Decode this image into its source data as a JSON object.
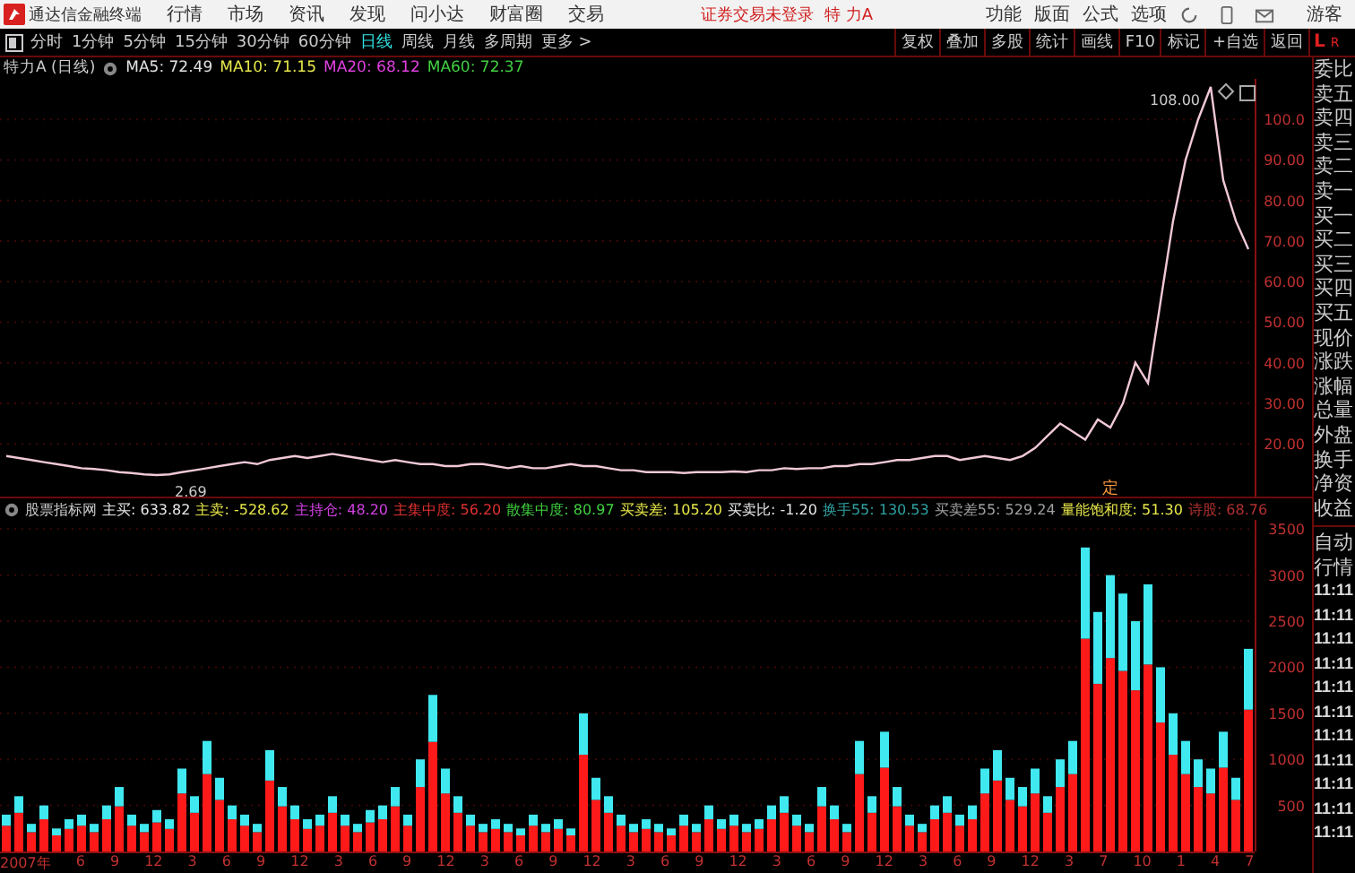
{
  "app_bar": {
    "app_name": "通达信金融终端",
    "menu": [
      "行情",
      "市场",
      "资讯",
      "发现",
      "问小达",
      "财富圈",
      "交易"
    ],
    "login_status": "证券交易未登录",
    "stock_name": "特 力A",
    "right_menu": [
      "功能",
      "版面",
      "公式",
      "选项"
    ],
    "user": "游客"
  },
  "period_bar": {
    "periods": [
      {
        "label": "分时",
        "selected": false
      },
      {
        "label": "1分钟",
        "selected": false
      },
      {
        "label": "5分钟",
        "selected": false
      },
      {
        "label": "15分钟",
        "selected": false
      },
      {
        "label": "30分钟",
        "selected": false
      },
      {
        "label": "60分钟",
        "selected": false
      },
      {
        "label": "日线",
        "selected": true
      },
      {
        "label": "周线",
        "selected": false
      },
      {
        "label": "月线",
        "selected": false
      },
      {
        "label": "多周期",
        "selected": false
      }
    ],
    "more": "更多 >",
    "tools": [
      "复权",
      "叠加",
      "多股",
      "统计",
      "画线",
      "F10",
      "标记",
      "+自选",
      "返回"
    ],
    "corner": [
      "L",
      "R"
    ]
  },
  "legend": {
    "stock": "特力A (日线)",
    "ma": [
      {
        "label": "MA5:",
        "value": "72.49",
        "color": "#e0e0e0"
      },
      {
        "label": "MA10:",
        "value": "71.15",
        "color": "#e6e64a"
      },
      {
        "label": "MA20:",
        "value": "68.12",
        "color": "#e040e0"
      },
      {
        "label": "MA60:",
        "value": "72.37",
        "color": "#40d040"
      }
    ]
  },
  "price_chart": {
    "chart_data": {
      "type": "line",
      "ylim": [
        7,
        110
      ],
      "yticks": [
        {
          "value": 20,
          "label": "20.00"
        },
        {
          "value": 30,
          "label": "30.00"
        },
        {
          "value": 40,
          "label": "40.00"
        },
        {
          "value": 50,
          "label": "50.00"
        },
        {
          "value": 60,
          "label": "60.00"
        },
        {
          "value": 70,
          "label": "70.00"
        },
        {
          "value": 80,
          "label": "80.00"
        },
        {
          "value": 90,
          "label": "90.00"
        },
        {
          "value": 100,
          "label": "100.0"
        }
      ],
      "series": [
        {
          "color": "#f0c8d8",
          "values": [
            17,
            16.5,
            16,
            15.5,
            15,
            14.5,
            14,
            13.8,
            13.5,
            13,
            12.8,
            12.5,
            12.3,
            12.5,
            13,
            13.5,
            14,
            14.5,
            15,
            15.5,
            15,
            16,
            16.5,
            17,
            16.5,
            17,
            17.5,
            17,
            16.5,
            16,
            15.5,
            16,
            15.5,
            15,
            15,
            14.5,
            14.5,
            15,
            15,
            14.5,
            14,
            14.5,
            14,
            14,
            14.5,
            15,
            14.5,
            14.5,
            14,
            13.5,
            13.5,
            13,
            13,
            13,
            12.8,
            13,
            13,
            13,
            13.2,
            13,
            13.5,
            13.5,
            14,
            13.8,
            14,
            14,
            14.5,
            14.5,
            15,
            15,
            15.5,
            16,
            16,
            16.5,
            17,
            17,
            16,
            16.5,
            17,
            16.5,
            16,
            17,
            19,
            22,
            25,
            23,
            21,
            26,
            24,
            30,
            40,
            35,
            55,
            75,
            90,
            100,
            108,
            85,
            75,
            68
          ]
        }
      ],
      "grid": true,
      "annotations": [
        "108.00",
        "2.69",
        "定"
      ]
    }
  },
  "indicator": {
    "name": "股票指标网",
    "items": [
      {
        "label": "主买:",
        "value": "633.82",
        "color": "#e8e8e8"
      },
      {
        "label": "主卖:",
        "value": "-528.62",
        "color": "#e6e64a"
      },
      {
        "label": "主持仓:",
        "value": "48.20",
        "color": "#d040e0"
      },
      {
        "label": "主集中度:",
        "value": "56.20",
        "color": "#e03030"
      },
      {
        "label": "散集中度:",
        "value": "80.97",
        "color": "#40d040"
      },
      {
        "label": "买卖差:",
        "value": "105.20",
        "color": "#e6e64a"
      },
      {
        "label": "买卖比:",
        "value": "-1.20",
        "color": "#e8e8e8"
      },
      {
        "label": "换手55:",
        "value": "130.53",
        "color": "#30a0a0"
      },
      {
        "label": "买卖差55:",
        "value": "529.24",
        "color": "#a0a0a0"
      },
      {
        "label": "量能饱和度:",
        "value": "51.30",
        "color": "#e6e64a"
      },
      {
        "label": "诗股:",
        "value": "68.76",
        "color": "#b03030"
      }
    ]
  },
  "volume_chart": {
    "chart_data": {
      "type": "bar",
      "stacked": true,
      "grid": true,
      "ylim": [
        0,
        3600
      ],
      "yticks": [
        500,
        1000,
        1500,
        2000,
        2500,
        3000,
        3500
      ],
      "series": [
        {
          "color": "#ff1a1a",
          "values": [
            280,
            420,
            210,
            350,
            175,
            245,
            280,
            210,
            350,
            490,
            280,
            210,
            315,
            245,
            630,
            420,
            840,
            560,
            350,
            280,
            210,
            770,
            490,
            350,
            245,
            280,
            420,
            280,
            210,
            315,
            350,
            490,
            280,
            700,
            1190,
            630,
            420,
            280,
            210,
            245,
            210,
            175,
            280,
            210,
            245,
            175,
            1050,
            560,
            420,
            280,
            210,
            245,
            210,
            175,
            280,
            210,
            350,
            245,
            280,
            210,
            245,
            350,
            420,
            280,
            210,
            490,
            350,
            210,
            840,
            420,
            910,
            490,
            280,
            210,
            350,
            420,
            280,
            350,
            630,
            770,
            560,
            490,
            630,
            420,
            700,
            840,
            2310,
            1820,
            2100,
            1960,
            1750,
            2030,
            1400,
            1050,
            840,
            700,
            630,
            910,
            560,
            1540
          ]
        },
        {
          "color": "#40e8f0",
          "values": [
            120,
            180,
            90,
            150,
            75,
            105,
            120,
            90,
            150,
            210,
            120,
            90,
            135,
            105,
            270,
            180,
            360,
            240,
            150,
            120,
            90,
            330,
            210,
            150,
            105,
            120,
            180,
            120,
            90,
            135,
            150,
            210,
            120,
            300,
            510,
            270,
            180,
            120,
            90,
            105,
            90,
            75,
            120,
            90,
            105,
            75,
            450,
            240,
            180,
            120,
            90,
            105,
            90,
            75,
            120,
            90,
            150,
            105,
            120,
            90,
            105,
            150,
            180,
            120,
            90,
            210,
            150,
            90,
            360,
            180,
            390,
            210,
            120,
            90,
            150,
            180,
            120,
            150,
            270,
            330,
            240,
            210,
            270,
            180,
            300,
            360,
            990,
            780,
            900,
            840,
            750,
            870,
            600,
            450,
            360,
            300,
            270,
            390,
            240,
            660
          ]
        }
      ]
    }
  },
  "date_axis": [
    "2007年",
    "6",
    "9",
    "12",
    "3",
    "6",
    "9",
    "12",
    "3",
    "6",
    "9",
    "12",
    "3",
    "6",
    "9",
    "12",
    "3",
    "6",
    "9",
    "12",
    "3",
    "6",
    "9",
    "12",
    "3",
    "6",
    "9",
    "12",
    "3",
    "7",
    "10",
    "1",
    "4",
    "7"
  ],
  "quote_panel": {
    "labels": [
      "委比",
      "卖五",
      "卖四",
      "卖三",
      "卖二",
      "卖一",
      "买一",
      "买二",
      "买三",
      "买四",
      "买五",
      "现价",
      "涨跌",
      "涨幅",
      "总量",
      "外盘",
      "换手",
      "净资",
      "收益"
    ],
    "mode": [
      "自动",
      "行情"
    ],
    "times": [
      "11:11",
      "11:11",
      "11:11",
      "11:11",
      "11:11",
      "11:11",
      "11:11",
      "11:11",
      "11:11",
      "11:11",
      "11:11"
    ]
  }
}
